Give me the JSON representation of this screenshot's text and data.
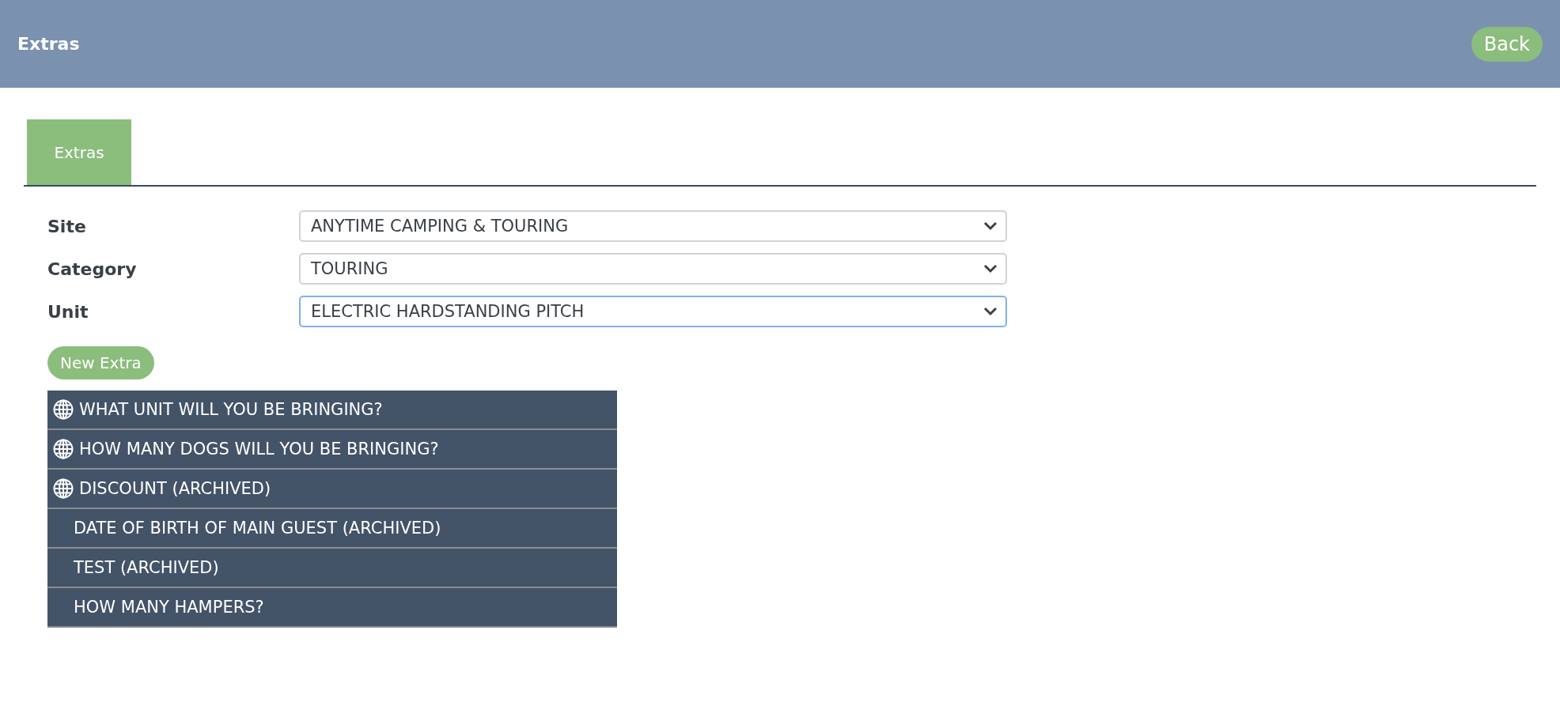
{
  "header": {
    "title": "Extras",
    "back_button": "Back"
  },
  "tabs": [
    {
      "label": "Extras",
      "selected": true
    }
  ],
  "form": {
    "fields": [
      {
        "label": "Site",
        "value": "ANYTIME CAMPING & TOURING",
        "focused": false
      },
      {
        "label": "Category",
        "value": "TOURING",
        "focused": false
      },
      {
        "label": "Unit",
        "value": "ELECTRIC HARDSTANDING PITCH",
        "focused": true
      }
    ]
  },
  "new_button": "New Extra",
  "extras": [
    {
      "label": "WHAT UNIT WILL YOU BE BRINGING?",
      "global": true
    },
    {
      "label": "HOW MANY DOGS WILL YOU BE BRINGING?",
      "global": true
    },
    {
      "label": "DISCOUNT (ARCHIVED)",
      "global": true
    },
    {
      "label": "DATE OF BIRTH OF MAIN GUEST (ARCHIVED)",
      "global": false
    },
    {
      "label": "TEST (ARCHIVED)",
      "global": false
    },
    {
      "label": "HOW MANY HAMPERS?",
      "global": false
    }
  ]
}
